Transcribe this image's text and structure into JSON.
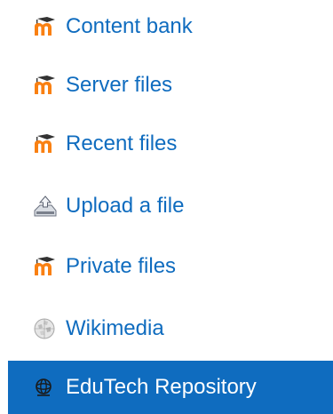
{
  "repositories": {
    "items": [
      {
        "label": "Content bank",
        "icon": "moodle-icon"
      },
      {
        "label": "Server files",
        "icon": "moodle-icon"
      },
      {
        "label": "Recent files",
        "icon": "moodle-icon"
      },
      {
        "label": "Upload a file",
        "icon": "upload-icon"
      },
      {
        "label": "Private files",
        "icon": "moodle-icon"
      },
      {
        "label": "Wikimedia",
        "icon": "wikimedia-icon"
      },
      {
        "label": "EduTech Repository",
        "icon": "edutech-icon",
        "selected": true
      }
    ],
    "colors": {
      "link": "#0f6cbf",
      "selected_background": "#0f6cbf",
      "selected_text": "#ffffff",
      "moodle_orange": "#f98012",
      "moodle_cap": "#333333"
    }
  }
}
